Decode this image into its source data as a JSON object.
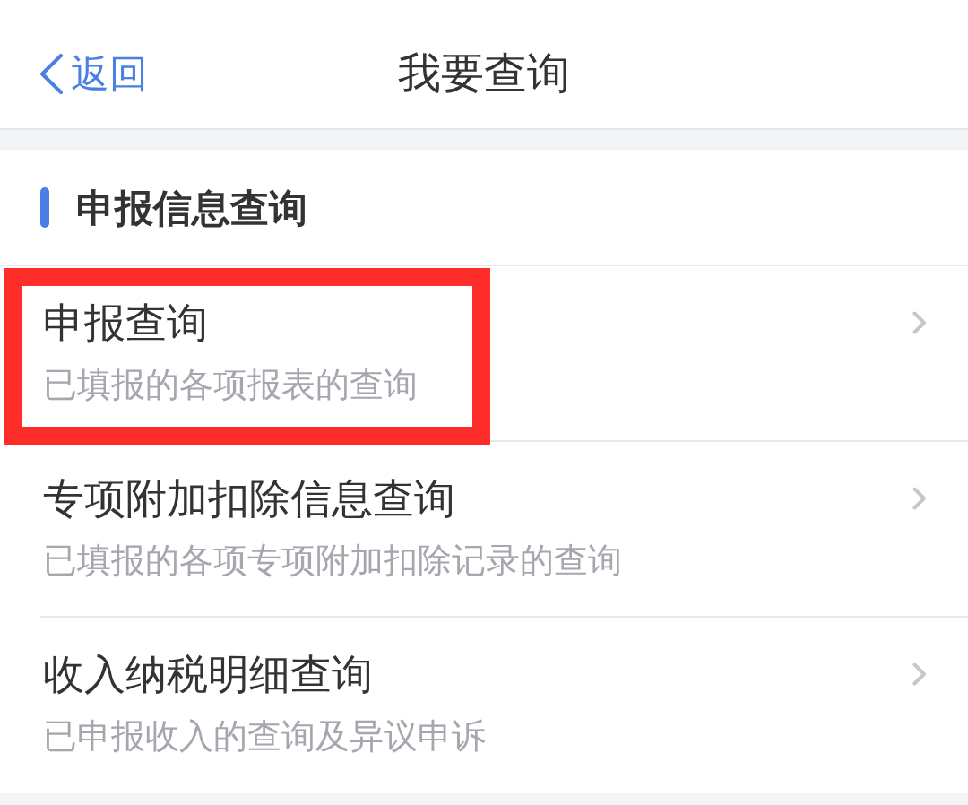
{
  "nav_bar": {
    "back_label": "返回",
    "title": "我要查询"
  },
  "section": {
    "title": "申报信息查询",
    "items": [
      {
        "title": "申报查询",
        "description": "已填报的各项报表的查询",
        "highlighted": true
      },
      {
        "title": "专项附加扣除信息查询",
        "description": "已填报的各项专项附加扣除记录的查询",
        "highlighted": false
      },
      {
        "title": "收入纳税明细查询",
        "description": "已申报收入的查询及异议申诉",
        "highlighted": false
      }
    ]
  }
}
